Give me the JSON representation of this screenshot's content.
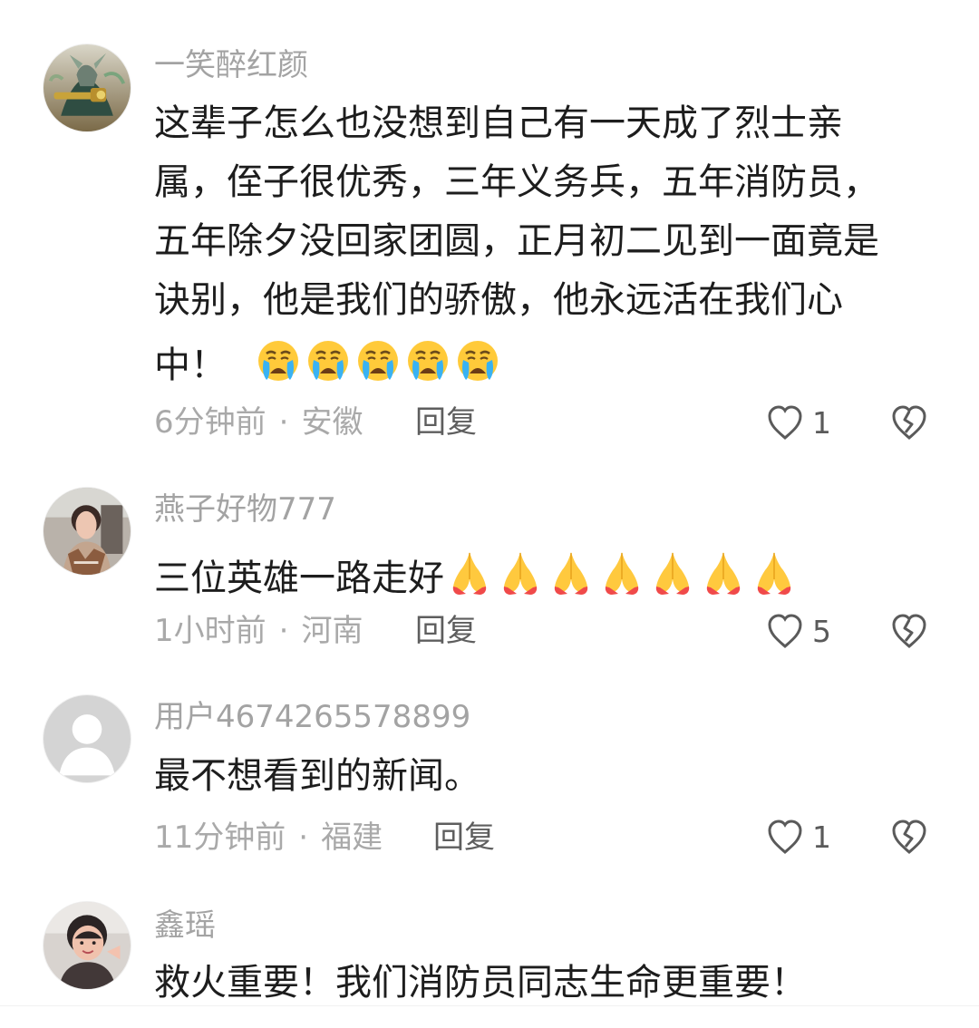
{
  "comments": [
    {
      "username": "一笑醉红颜",
      "avatar_icon": "warrior-avatar-icon",
      "lines": [
        "这辈子怎么也没想到自己有一天成了烈士亲",
        "属，侄子很优秀，三年义务兵，五年消防员，",
        "五年除夕没回家团圆，正月初二见到一面竟是",
        "诀别，他是我们的骄傲，他永远活在我们心",
        "中！"
      ],
      "emoji_icon": "crying-face-icon",
      "emoji_count": 5,
      "time": "6分钟前",
      "location": "安徽",
      "reply": "回复",
      "likes": "1"
    },
    {
      "username": "燕子好物777",
      "avatar_icon": "woman-avatar-icon",
      "lines": [
        "三位英雄一路走好"
      ],
      "emoji_icon": "praying-hands-icon",
      "emoji_count": 7,
      "time": "1小时前",
      "location": "河南",
      "reply": "回复",
      "likes": "5"
    },
    {
      "username": "用户4674265578899",
      "avatar_icon": "default-user-avatar-icon",
      "lines": [
        "最不想看到的新闻。"
      ],
      "time": "11分钟前",
      "location": "福建",
      "reply": "回复",
      "likes": "1"
    },
    {
      "username": "鑫瑶",
      "avatar_icon": "child-avatar-icon",
      "lines": [
        "救火重要！我们消防员同志生命更重要！"
      ]
    }
  ],
  "colors": {
    "username": "#a3a3a3",
    "meta": "#a9a9a9",
    "reply": "#5e5e5e",
    "content": "#1d1d1d",
    "icon": "#5a5a5a"
  }
}
